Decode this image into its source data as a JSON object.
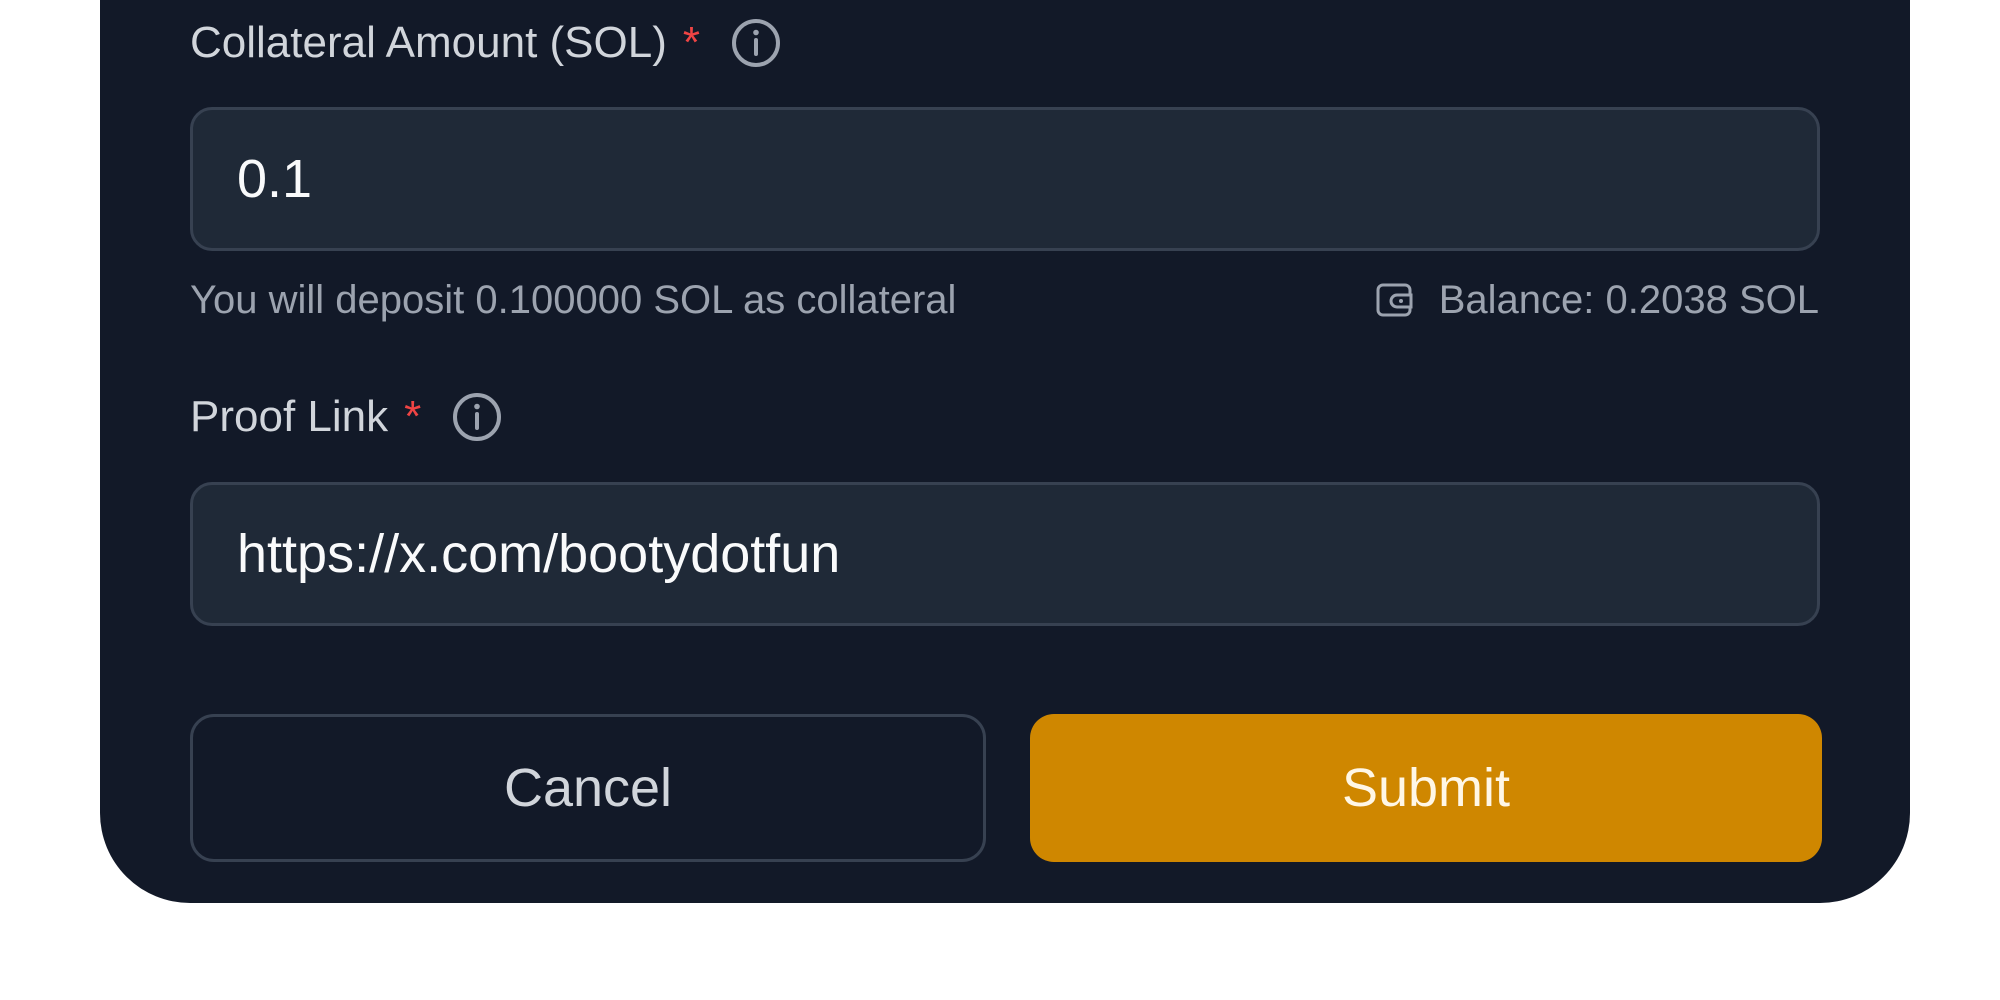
{
  "form": {
    "collateral": {
      "label": "Collateral Amount (SOL)",
      "required_marker": "*",
      "value": "0.1",
      "hint": "You will deposit 0.100000 SOL as collateral",
      "balance": "Balance: 0.2038 SOL"
    },
    "proof": {
      "label": "Proof Link",
      "required_marker": "*",
      "value": "https://x.com/bootydotfun"
    },
    "buttons": {
      "cancel": "Cancel",
      "submit": "Submit"
    }
  },
  "icons": {
    "info": "info-icon",
    "wallet": "wallet-icon"
  },
  "colors": {
    "card_bg": "#121928",
    "input_bg": "#1f2937",
    "required": "#ef4444",
    "accent": "#cf8700"
  }
}
